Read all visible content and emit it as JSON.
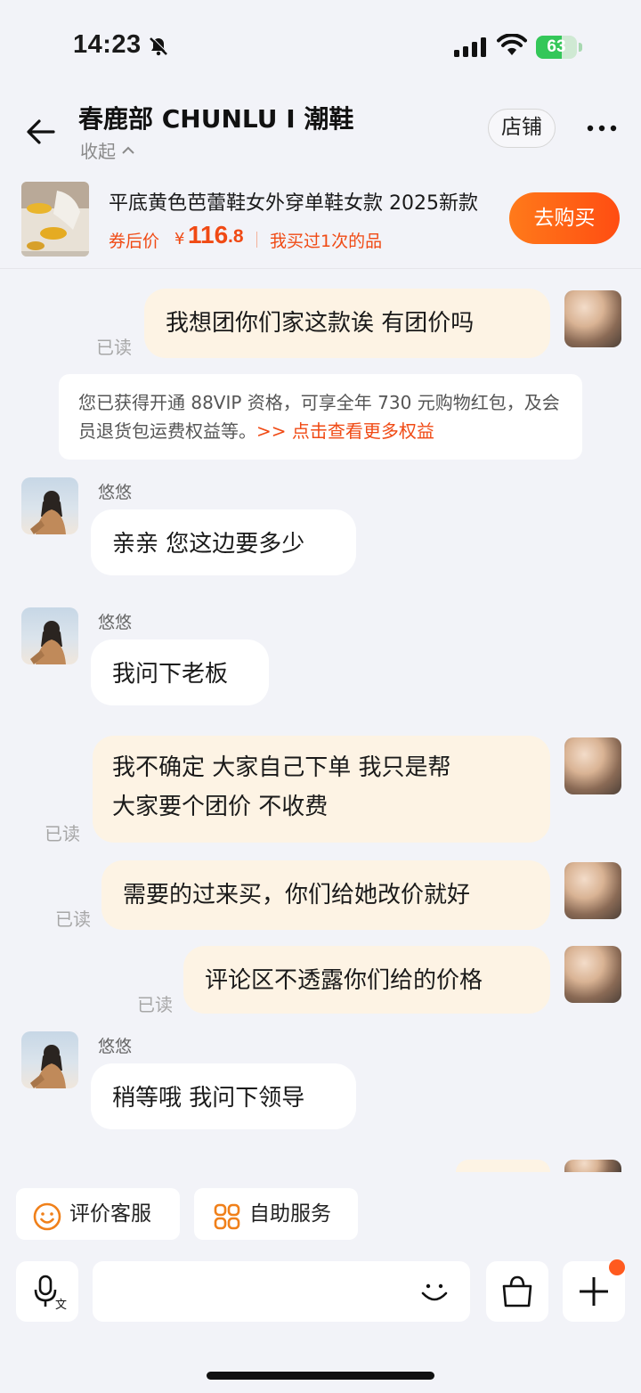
{
  "status_bar": {
    "time": "14:23",
    "battery": "63",
    "battery_level": 0.63
  },
  "header": {
    "title": "春鹿部 CHUNLU I 潮鞋",
    "collapse_label": "收起",
    "store_button": "店铺"
  },
  "product": {
    "name": "平底黄色芭蕾鞋女外穿单鞋女款 2025新款",
    "price_label": "券后价",
    "currency": "¥",
    "price_int": "116",
    "price_dec": ".8",
    "bought_text": "我买过1次的品",
    "buy_button": "去购买"
  },
  "messages": {
    "m1": {
      "text": "我想团你们家这款诶  有团价吗",
      "status": "已读"
    },
    "notice": {
      "text": "您已获得开通 88VIP 资格，可享全年 730 元购物红包，及会员退货包运费权益等。",
      "link": ">> 点击查看更多权益"
    },
    "m2": {
      "sender": "悠悠",
      "text": "亲亲 您这边要多少"
    },
    "m3": {
      "sender": "悠悠",
      "text": "我问下老板"
    },
    "m4": {
      "line1": "我不确定 大家自己下单 我只是帮",
      "line2": "大家要个团价  不收费",
      "status": "已读"
    },
    "m5": {
      "text": "需要的过来买，你们给她改价就好",
      "status": "已读"
    },
    "m6": {
      "text": "评论区不透露你们给的价格",
      "status": "已读"
    },
    "m7": {
      "sender": "悠悠",
      "text": "稍等哦 我问下领导"
    }
  },
  "quick_actions": {
    "rate": "评价客服",
    "self_service": "自助服务"
  },
  "input": {
    "placeholder": ""
  },
  "colors": {
    "accent": "#f04a14",
    "my_bubble": "#fdf3e4",
    "background": "#f2f3f8"
  }
}
